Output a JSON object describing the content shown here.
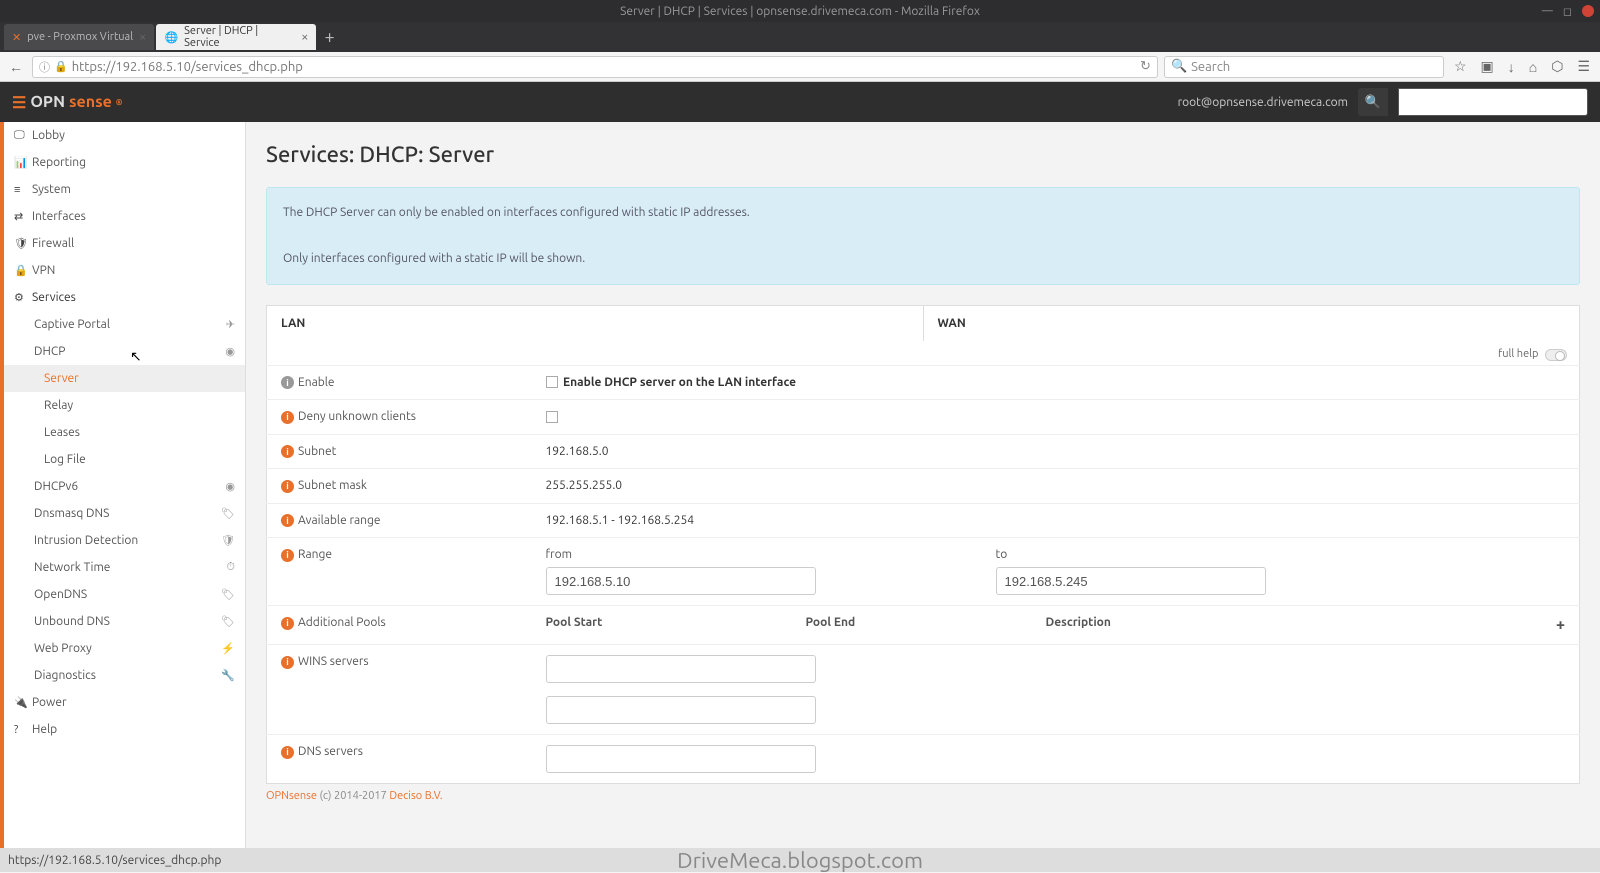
{
  "window": {
    "title": "Server | DHCP | Services | opnsense.drivemeca.com - Mozilla Firefox"
  },
  "browser_tabs": [
    {
      "label": "pve - Proxmox Virtual",
      "active": false
    },
    {
      "label": "Server | DHCP | Service",
      "active": true
    }
  ],
  "url": "https://192.168.5.10/services_dhcp.php",
  "search_placeholder": "Search",
  "opnsense": {
    "logo1": "OPN",
    "logo2": "sense",
    "user": "root@opnsense.drivemeca.com"
  },
  "sidebar": {
    "top": [
      {
        "icon": "🖵",
        "label": "Lobby"
      },
      {
        "icon": "📊",
        "label": "Reporting"
      },
      {
        "icon": "≡",
        "label": "System"
      },
      {
        "icon": "⇄",
        "label": "Interfaces"
      },
      {
        "icon": "🛡",
        "label": "Firewall"
      },
      {
        "icon": "🔒",
        "label": "VPN"
      },
      {
        "icon": "⚙",
        "label": "Services"
      }
    ],
    "services_sub": [
      {
        "label": "Captive Portal",
        "ricon": "✈"
      },
      {
        "label": "DHCP",
        "ricon": "◉"
      }
    ],
    "dhcp_sub": [
      {
        "label": "Server",
        "active": true
      },
      {
        "label": "Relay"
      },
      {
        "label": "Leases"
      },
      {
        "label": "Log File"
      }
    ],
    "services_sub2": [
      {
        "label": "DHCPv6",
        "ricon": "◉"
      },
      {
        "label": "Dnsmasq DNS",
        "ricon": "🏷"
      },
      {
        "label": "Intrusion Detection",
        "ricon": "🛡"
      },
      {
        "label": "Network Time",
        "ricon": "⏱"
      },
      {
        "label": "OpenDNS",
        "ricon": "🏷"
      },
      {
        "label": "Unbound DNS",
        "ricon": "🏷"
      },
      {
        "label": "Web Proxy",
        "ricon": "⚡"
      },
      {
        "label": "Diagnostics",
        "ricon": "🔧"
      }
    ],
    "bottom": [
      {
        "icon": "🔌",
        "label": "Power"
      },
      {
        "icon": "?",
        "label": "Help"
      }
    ]
  },
  "page": {
    "title": "Services: DHCP: Server",
    "alert_line1": "The DHCP Server can only be enabled on interfaces configured with static IP addresses.",
    "alert_line2": "Only interfaces configured with a static IP will be shown.",
    "tabs": {
      "lan": "LAN",
      "wan": "WAN"
    },
    "fullhelp": "full help",
    "rows": {
      "enable": {
        "label": "Enable",
        "desc": "Enable DHCP server on the LAN interface"
      },
      "deny": {
        "label": "Deny unknown clients"
      },
      "subnet": {
        "label": "Subnet",
        "value": "192.168.5.0"
      },
      "mask": {
        "label": "Subnet mask",
        "value": "255.255.255.0"
      },
      "avail": {
        "label": "Available range",
        "value": "192.168.5.1 - 192.168.5.254"
      },
      "range": {
        "label": "Range",
        "from_label": "from",
        "to_label": "to",
        "from": "192.168.5.10",
        "to": "192.168.5.245"
      },
      "pools": {
        "label": "Additional Pools",
        "h1": "Pool Start",
        "h2": "Pool End",
        "h3": "Description"
      },
      "wins": {
        "label": "WINS servers"
      },
      "dns": {
        "label": "DNS servers"
      }
    }
  },
  "footer": {
    "brand": "OPNsense",
    "copyright": " (c) 2014-2017 ",
    "vendor": "Deciso B.V."
  },
  "statusbar": "https://192.168.5.10/services_dhcp.php",
  "watermark": "DriveMeca.blogspot.com"
}
